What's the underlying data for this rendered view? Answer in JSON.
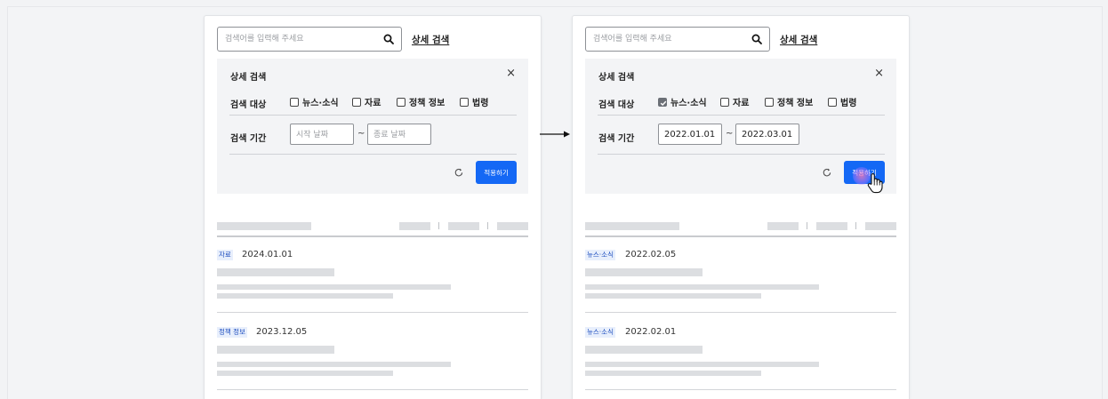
{
  "search": {
    "placeholder": "검색어를 입력해 주세요",
    "advanced_label": "상세 검색"
  },
  "filter": {
    "title": "상세 검색",
    "close_symbol": "×",
    "target_label": "검색 대상",
    "period_label": "검색 기간",
    "options": [
      "뉴스·소식",
      "자료",
      "정책 정보",
      "법령"
    ],
    "start_placeholder": "시작 날짜",
    "end_placeholder": "종료 날짜",
    "range_sep": "~",
    "apply_label": "적용하기"
  },
  "left": {
    "checked": [
      false,
      false,
      false,
      false
    ],
    "start_value": "",
    "end_value": "",
    "results": [
      {
        "tag": "자료",
        "date": "2024.01.01"
      },
      {
        "tag": "정책 정보",
        "date": "2023.12.05"
      }
    ]
  },
  "right": {
    "checked": [
      true,
      false,
      false,
      false
    ],
    "start_value": "2022.01.01",
    "end_value": "2022.03.01",
    "results": [
      {
        "tag": "뉴스·소식",
        "date": "2022.02.05"
      },
      {
        "tag": "뉴스·소식",
        "date": "2022.02.01"
      }
    ]
  },
  "icons": {
    "search": "search-icon",
    "close": "close-icon",
    "reset": "reset-icon",
    "arrow": "arrow-right-icon",
    "cursor": "hand-cursor-icon"
  },
  "colors": {
    "primary": "#1468f5",
    "tag_bg": "#e8effc",
    "tag_text": "#1f4fbf",
    "placeholder": "#dcdee1"
  }
}
